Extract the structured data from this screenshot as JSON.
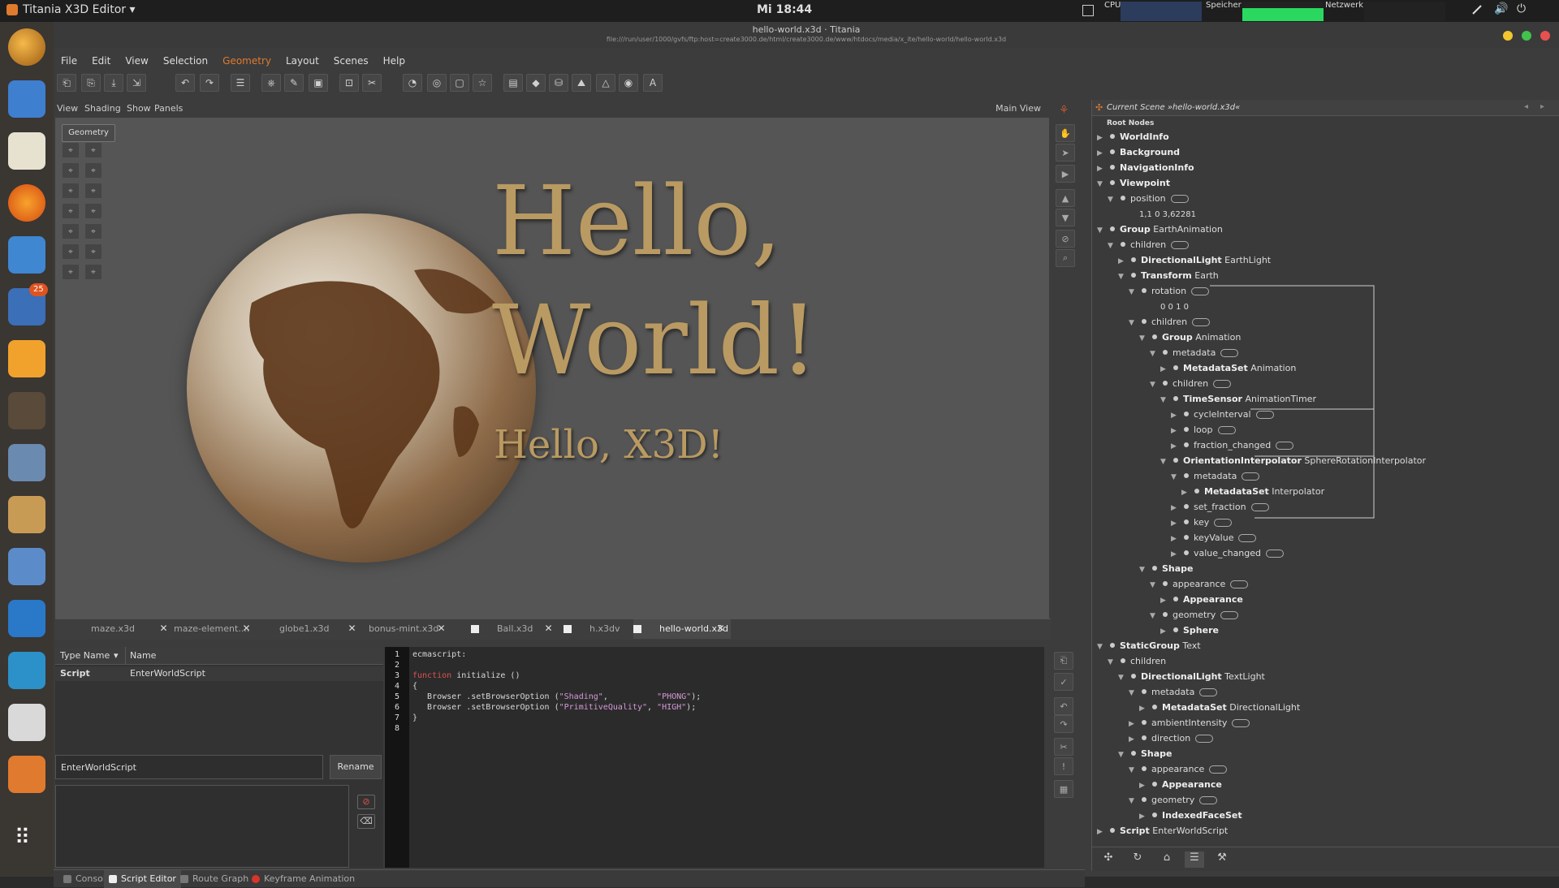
{
  "topbar": {
    "app_name": "Titania X3D Editor ▾",
    "clock": "Mi 18:44",
    "cpu_label": "CPU",
    "mem_label": "Speicher",
    "net_label": "Netzwerk"
  },
  "launcher": {
    "badge": "25",
    "icons": [
      "search-icon",
      "file-manager-icon",
      "text-editor-icon",
      "firefox-icon",
      "chromium-icon",
      "calendar-icon",
      "bluefish-icon",
      "speaker-icon",
      "paint-icon",
      "inkscape-icon",
      "blender-icon",
      "graph-icon",
      "monitor-icon",
      "calculator-icon",
      "titania-icon",
      "apps-grid-icon"
    ]
  },
  "window": {
    "title": "hello-world.x3d · Titania",
    "path": "file:///run/user/1000/gvfs/ftp:host=create3000.de/html/create3000.de/www/htdocs/media/x_ite/hello-world/hello-world.x3d"
  },
  "menu": [
    "File",
    "Edit",
    "View",
    "Selection",
    "Geometry",
    "Layout",
    "Scenes",
    "Help"
  ],
  "menu_active": "Geometry",
  "viewport": {
    "menu": [
      "View",
      "Shading",
      "Show",
      "Panels"
    ],
    "label": "Main View",
    "geometry_tab": "Geometry",
    "text_hello": "Hello,",
    "text_world": "World!",
    "text_x3d": "Hello, X3D!"
  },
  "tabs": [
    {
      "label": "maze.x3d"
    },
    {
      "label": "maze-element...."
    },
    {
      "label": "globe1.x3d"
    },
    {
      "label": "bonus-mint.x3d"
    },
    {
      "label": "Ball.x3d"
    },
    {
      "label": "h.x3dv"
    },
    {
      "label": "hello-world.x3d",
      "active": true
    }
  ],
  "script_list": {
    "col_type": "Type Name",
    "col_name": "Name",
    "rows": [
      {
        "type": "Script",
        "name": "EnterWorldScript"
      }
    ],
    "name_value": "EnterWorldScript",
    "rename": "Rename"
  },
  "code": {
    "line_numbers": [
      "1",
      "2",
      "3",
      "4",
      "5",
      "6",
      "7",
      "8"
    ],
    "lines": [
      "ecmascript:",
      "",
      "function initialize ()",
      "{",
      "   Browser .setBrowserOption (\"Shading\",          \"PHONG\");",
      "   Browser .setBrowserOption (\"PrimitiveQuality\", \"HIGH\");",
      "}",
      ""
    ]
  },
  "bottom_tabs": [
    "Console",
    "Script Editor",
    "Route Graph",
    "Keyframe Animation"
  ],
  "scene": {
    "header": "Current Scene »hello-world.x3d«",
    "root_label": "Root Nodes",
    "rows": [
      {
        "d": 0,
        "a": "▶",
        "t": "n",
        "b": "WorldInfo",
        "s": ""
      },
      {
        "d": 0,
        "a": "▶",
        "t": "n",
        "b": "Background",
        "s": ""
      },
      {
        "d": 0,
        "a": "▶",
        "t": "n",
        "b": "NavigationInfo",
        "s": ""
      },
      {
        "d": 0,
        "a": "▼",
        "t": "n",
        "b": "Viewpoint",
        "s": ""
      },
      {
        "d": 1,
        "a": "▼",
        "t": "f",
        "b": "",
        "s": "position",
        "c": true
      },
      {
        "d": 2,
        "a": "",
        "t": "v",
        "b": "",
        "s": "1,1 0 3,62281"
      },
      {
        "d": 0,
        "a": "▼",
        "t": "n",
        "b": "Group",
        "s": "EarthAnimation"
      },
      {
        "d": 1,
        "a": "▼",
        "t": "f",
        "b": "",
        "s": "children",
        "c": true
      },
      {
        "d": 2,
        "a": "▶",
        "t": "n",
        "b": "DirectionalLight",
        "s": "EarthLight"
      },
      {
        "d": 2,
        "a": "▼",
        "t": "n",
        "b": "Transform",
        "s": "Earth"
      },
      {
        "d": 3,
        "a": "▼",
        "t": "f",
        "b": "",
        "s": "rotation",
        "c": true
      },
      {
        "d": 4,
        "a": "",
        "t": "v",
        "b": "",
        "s": "0 0 1 0"
      },
      {
        "d": 3,
        "a": "▼",
        "t": "f",
        "b": "",
        "s": "children",
        "c": true
      },
      {
        "d": 4,
        "a": "▼",
        "t": "n",
        "b": "Group",
        "s": "Animation"
      },
      {
        "d": 5,
        "a": "▼",
        "t": "f",
        "b": "",
        "s": "metadata",
        "c": true
      },
      {
        "d": 6,
        "a": "▶",
        "t": "n",
        "b": "MetadataSet",
        "s": "Animation"
      },
      {
        "d": 5,
        "a": "▼",
        "t": "f",
        "b": "",
        "s": "children",
        "c": true
      },
      {
        "d": 6,
        "a": "▼",
        "t": "n",
        "b": "TimeSensor",
        "s": "AnimationTimer"
      },
      {
        "d": 7,
        "a": "▶",
        "t": "f",
        "b": "",
        "s": "cycleInterval",
        "c": true
      },
      {
        "d": 7,
        "a": "▶",
        "t": "f",
        "b": "",
        "s": "loop",
        "c": true
      },
      {
        "d": 7,
        "a": "▶",
        "t": "f",
        "b": "",
        "s": "fraction_changed",
        "c": true
      },
      {
        "d": 6,
        "a": "▼",
        "t": "n",
        "b": "OrientationInterpolator",
        "s": "SphereRotationInterpolator"
      },
      {
        "d": 7,
        "a": "▼",
        "t": "f",
        "b": "",
        "s": "metadata",
        "c": true
      },
      {
        "d": 8,
        "a": "▶",
        "t": "n",
        "b": "MetadataSet",
        "s": "Interpolator"
      },
      {
        "d": 7,
        "a": "▶",
        "t": "f",
        "b": "",
        "s": "set_fraction",
        "c": true
      },
      {
        "d": 7,
        "a": "▶",
        "t": "f",
        "b": "",
        "s": "key",
        "c": true
      },
      {
        "d": 7,
        "a": "▶",
        "t": "f",
        "b": "",
        "s": "keyValue",
        "c": true
      },
      {
        "d": 7,
        "a": "▶",
        "t": "f",
        "b": "",
        "s": "value_changed",
        "c": true
      },
      {
        "d": 4,
        "a": "▼",
        "t": "n",
        "b": "Shape",
        "s": ""
      },
      {
        "d": 5,
        "a": "▼",
        "t": "f",
        "b": "",
        "s": "appearance",
        "c": true
      },
      {
        "d": 6,
        "a": "▶",
        "t": "n",
        "b": "Appearance",
        "s": ""
      },
      {
        "d": 5,
        "a": "▼",
        "t": "f",
        "b": "",
        "s": "geometry",
        "c": true
      },
      {
        "d": 6,
        "a": "▶",
        "t": "n",
        "b": "Sphere",
        "s": ""
      },
      {
        "d": 0,
        "a": "▼",
        "t": "n",
        "b": "StaticGroup",
        "s": "Text"
      },
      {
        "d": 1,
        "a": "▼",
        "t": "f",
        "b": "",
        "s": "children"
      },
      {
        "d": 2,
        "a": "▼",
        "t": "n",
        "b": "DirectionalLight",
        "s": "TextLight"
      },
      {
        "d": 3,
        "a": "▼",
        "t": "f",
        "b": "",
        "s": "metadata",
        "c": true
      },
      {
        "d": 4,
        "a": "▶",
        "t": "n",
        "b": "MetadataSet",
        "s": "DirectionalLight"
      },
      {
        "d": 3,
        "a": "▶",
        "t": "f",
        "b": "",
        "s": "ambientIntensity",
        "c": true
      },
      {
        "d": 3,
        "a": "▶",
        "t": "f",
        "b": "",
        "s": "direction",
        "c": true
      },
      {
        "d": 2,
        "a": "▼",
        "t": "n",
        "b": "Shape",
        "s": ""
      },
      {
        "d": 3,
        "a": "▼",
        "t": "f",
        "b": "",
        "s": "appearance",
        "c": true
      },
      {
        "d": 4,
        "a": "▶",
        "t": "n",
        "b": "Appearance",
        "s": ""
      },
      {
        "d": 3,
        "a": "▼",
        "t": "f",
        "b": "",
        "s": "geometry",
        "c": true
      },
      {
        "d": 4,
        "a": "▶",
        "t": "n",
        "b": "IndexedFaceSet",
        "s": ""
      },
      {
        "d": 0,
        "a": "▶",
        "t": "n",
        "b": "Script",
        "s": "EnterWorldScript"
      }
    ]
  },
  "colors": {
    "accent": "#e07a2e",
    "gold": "#b99a62",
    "viewport_bg": "#555555"
  }
}
